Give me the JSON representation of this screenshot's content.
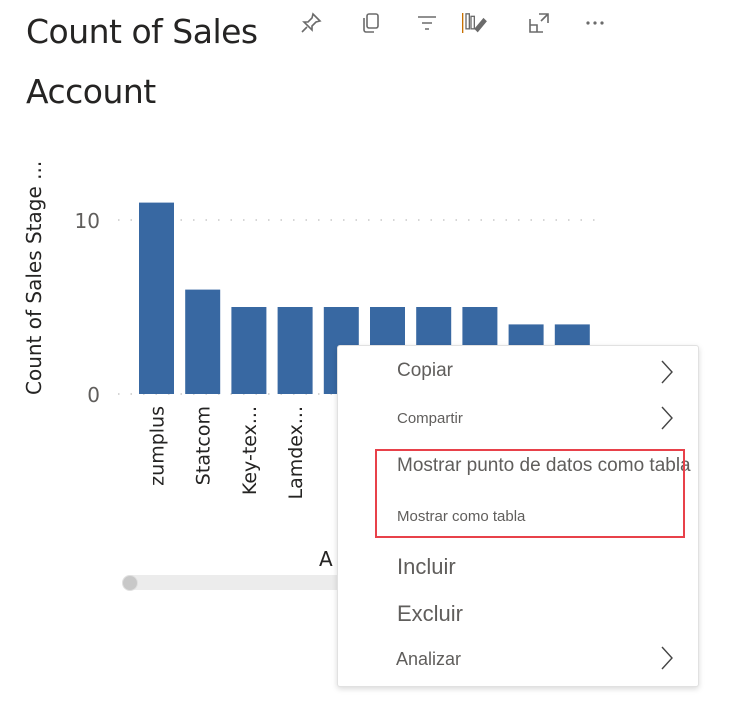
{
  "visual": {
    "title_line1": "Count of Sales",
    "title_line2": "Account",
    "toolbar_icons": [
      "pin-icon",
      "copy-icon",
      "filter-icon",
      "format-visual-icon",
      "focus-mode-icon",
      "more-options-icon"
    ]
  },
  "chart_data": {
    "type": "bar",
    "title": "Count of Sales Stage by Account",
    "ylabel": "Count of Sales Stage ...",
    "xlabel": "A",
    "ylim": [
      0,
      12
    ],
    "yticks": [
      0,
      10
    ],
    "grid": true,
    "categories": [
      "zumplus",
      "Statcom",
      "Key-tex...",
      "Lamdex...",
      "",
      "",
      "",
      "",
      "",
      ""
    ],
    "values": [
      11,
      6,
      5,
      5,
      5,
      5,
      5,
      5,
      4,
      4
    ],
    "bar_color": "#3868a2"
  },
  "context_menu": {
    "items": [
      {
        "label": "Copiar",
        "has_submenu": true
      },
      {
        "label": "Compartir",
        "has_submenu": true
      },
      {
        "label": "Mostrar punto de datos como tabla",
        "has_submenu": false
      },
      {
        "label": "Mostrar como tabla",
        "has_submenu": false
      },
      {
        "label": "Incluir",
        "has_submenu": false
      },
      {
        "label": "Excluir",
        "has_submenu": false
      },
      {
        "label": "Analizar",
        "has_submenu": true
      }
    ],
    "highlight_color": "#e8414a"
  }
}
